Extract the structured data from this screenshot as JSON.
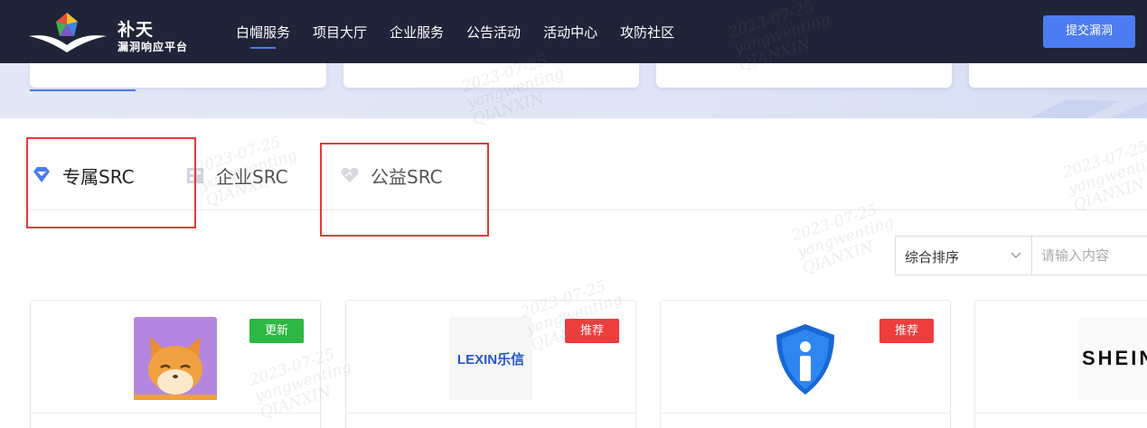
{
  "header": {
    "logo": {
      "title": "补天",
      "subtitle": "漏洞响应平台"
    },
    "nav": [
      {
        "label": "白帽服务",
        "active": true
      },
      {
        "label": "项目大厅",
        "active": false
      },
      {
        "label": "企业服务",
        "active": false
      },
      {
        "label": "公告活动",
        "active": false
      },
      {
        "label": "活动中心",
        "active": false
      },
      {
        "label": "攻防社区",
        "active": false
      }
    ],
    "submit_label": "提交漏洞"
  },
  "tabs": [
    {
      "label": "专属SRC",
      "icon": "diamond-icon",
      "active": true
    },
    {
      "label": "企业SRC",
      "icon": "building-icon",
      "active": false
    },
    {
      "label": "公益SRC",
      "icon": "heart-hands-icon",
      "active": false
    }
  ],
  "filter": {
    "sort_selected": "综合排序",
    "search_placeholder": "请输入内容"
  },
  "cards": [
    {
      "logo": "fox-avatar-icon",
      "badge": "更新",
      "badge_color": "#2db843"
    },
    {
      "logo_text": "LEXIN乐信",
      "badge": "推荐",
      "badge_color": "#ef3c3c"
    },
    {
      "logo": "shield-i-icon",
      "badge": "推荐",
      "badge_color": "#ef3c3c"
    },
    {
      "logo_text": "SHEIN"
    }
  ],
  "watermark": {
    "date": "2023-07-25",
    "user": "yangwenting",
    "org": "QIANXIN"
  },
  "colors": {
    "header_bg": "#1f2438",
    "accent": "#4c7cf2",
    "highlight_box": "#e53a3a"
  }
}
